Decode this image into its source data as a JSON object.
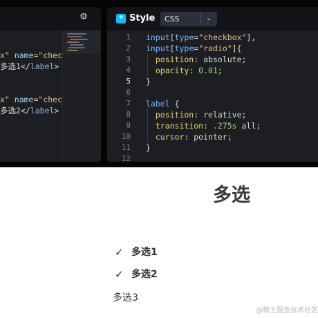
{
  "left_editor": {
    "gear_icon": "gear-icon",
    "code_lines": [
      {
        "parts": [
          {
            "t": "x\" ",
            "c": "t-astr"
          },
          {
            "t": "name",
            "c": "t-aname"
          },
          {
            "t": "=\"check",
            "c": "t-astr"
          }
        ]
      },
      {
        "parts": [
          {
            "t": "多选1",
            "c": "t-punc"
          },
          {
            "t": "</",
            "c": "t-punc"
          },
          {
            "t": "label",
            "c": "t-tag"
          },
          {
            "t": ">",
            "c": "t-punc"
          }
        ]
      },
      {
        "parts": [
          {
            "t": "x\" ",
            "c": "t-astr"
          },
          {
            "t": "name",
            "c": "t-aname"
          },
          {
            "t": "=\"check",
            "c": "t-astr"
          }
        ]
      },
      {
        "parts": [
          {
            "t": "多选2",
            "c": "t-punc"
          },
          {
            "t": "</",
            "c": "t-punc"
          },
          {
            "t": "label",
            "c": "t-tag"
          },
          {
            "t": ">",
            "c": "t-punc"
          }
        ]
      }
    ]
  },
  "style_editor": {
    "title": "Style",
    "language": "CSS",
    "active_line": 5,
    "line_numbers": [
      "1",
      "2",
      "3",
      "4",
      "5",
      "6",
      "7",
      "8",
      "9",
      "10",
      "11",
      "12"
    ],
    "lines": [
      [
        {
          "t": "input",
          "c": "t-sel"
        },
        {
          "t": "[",
          "c": "t-punc"
        },
        {
          "t": "type",
          "c": "t-attr"
        },
        {
          "t": "=",
          "c": "t-punc"
        },
        {
          "t": "\"checkbox\"",
          "c": "t-str"
        },
        {
          "t": "],",
          "c": "t-punc"
        }
      ],
      [
        {
          "t": "input",
          "c": "t-sel"
        },
        {
          "t": "[",
          "c": "t-punc"
        },
        {
          "t": "type",
          "c": "t-attr"
        },
        {
          "t": "=",
          "c": "t-punc"
        },
        {
          "t": "\"radio\"",
          "c": "t-str"
        },
        {
          "t": "]{",
          "c": "t-punc"
        }
      ],
      [
        {
          "t": "  position",
          "c": "t-prop"
        },
        {
          "t": ": ",
          "c": "t-punc"
        },
        {
          "t": "absolute",
          "c": "t-val"
        },
        {
          "t": ";",
          "c": "t-punc"
        }
      ],
      [
        {
          "t": "  opacity",
          "c": "t-prop"
        },
        {
          "t": ": ",
          "c": "t-punc"
        },
        {
          "t": "0.01",
          "c": "t-num"
        },
        {
          "t": ";",
          "c": "t-punc"
        }
      ],
      [
        {
          "t": "}",
          "c": "t-punc"
        }
      ],
      [],
      [
        {
          "t": "label",
          "c": "t-sel"
        },
        {
          "t": " {",
          "c": "t-punc"
        }
      ],
      [
        {
          "t": "  position",
          "c": "t-prop"
        },
        {
          "t": ": ",
          "c": "t-punc"
        },
        {
          "t": "relative",
          "c": "t-val"
        },
        {
          "t": ";",
          "c": "t-punc"
        }
      ],
      [
        {
          "t": "  transition",
          "c": "t-prop"
        },
        {
          "t": ": ",
          "c": "t-punc"
        },
        {
          "t": ".275s",
          "c": "t-num"
        },
        {
          "t": " all",
          "c": "t-val"
        },
        {
          "t": ";",
          "c": "t-punc"
        }
      ],
      [
        {
          "t": "  cursor",
          "c": "t-prop"
        },
        {
          "t": ": ",
          "c": "t-punc"
        },
        {
          "t": "pointer",
          "c": "t-val"
        },
        {
          "t": ";",
          "c": "t-punc"
        }
      ],
      [
        {
          "t": "}",
          "c": "t-punc"
        }
      ],
      []
    ]
  },
  "preview": {
    "title": "多选",
    "options": [
      {
        "label": "多选1",
        "checked": true
      },
      {
        "label": "多选2",
        "checked": true
      },
      {
        "label": "多选3",
        "checked": false
      }
    ],
    "check_glyph": "✓",
    "watermark": "@稀土掘金技术社区"
  },
  "colors": {
    "editor_bg": "#1d1e22",
    "header_bg": "#131417",
    "page_bg": "#ffffff",
    "text_dark": "#333333",
    "icon_blue": "#0ebeff"
  }
}
